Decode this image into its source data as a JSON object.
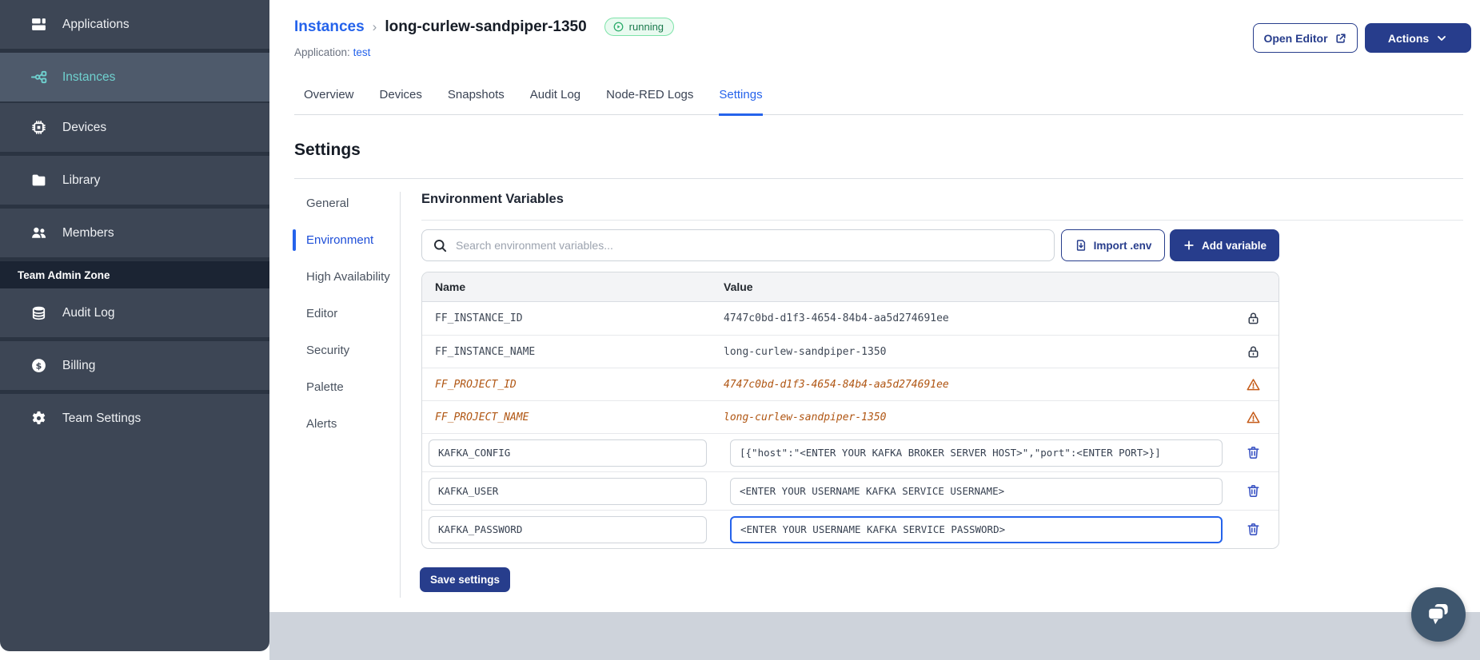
{
  "sidebar": {
    "items": [
      {
        "label": "Applications",
        "icon": "applications",
        "active": false
      },
      {
        "label": "Instances",
        "icon": "instances",
        "active": true
      },
      {
        "label": "Devices",
        "icon": "devices",
        "active": false
      },
      {
        "label": "Library",
        "icon": "library",
        "active": false
      },
      {
        "label": "Members",
        "icon": "members",
        "active": false
      }
    ],
    "section_label": "Team Admin Zone",
    "admin_items": [
      {
        "label": "Audit Log",
        "icon": "audit-log",
        "active": false
      },
      {
        "label": "Billing",
        "icon": "billing",
        "active": false
      },
      {
        "label": "Team Settings",
        "icon": "team-settings",
        "active": false
      }
    ]
  },
  "header": {
    "breadcrumb_root": "Instances",
    "breadcrumb_separator": "›",
    "instance_name": "long-curlew-sandpiper-1350",
    "status_badge": "running",
    "application_label": "Application:",
    "application_name": "test",
    "open_editor_label": "Open Editor",
    "actions_label": "Actions"
  },
  "tabs": [
    {
      "label": "Overview",
      "active": false
    },
    {
      "label": "Devices",
      "active": false
    },
    {
      "label": "Snapshots",
      "active": false
    },
    {
      "label": "Audit Log",
      "active": false
    },
    {
      "label": "Node-RED Logs",
      "active": false
    },
    {
      "label": "Settings",
      "active": true
    }
  ],
  "settings": {
    "title": "Settings",
    "nav": [
      {
        "label": "General",
        "active": false
      },
      {
        "label": "Environment",
        "active": true
      },
      {
        "label": "High Availability",
        "active": false
      },
      {
        "label": "Editor",
        "active": false
      },
      {
        "label": "Security",
        "active": false
      },
      {
        "label": "Palette",
        "active": false
      },
      {
        "label": "Alerts",
        "active": false
      }
    ],
    "section_title": "Environment Variables",
    "search_placeholder": "Search environment variables...",
    "import_label": "Import .env",
    "add_label": "Add variable",
    "save_label": "Save settings",
    "table": {
      "col_name": "Name",
      "col_value": "Value",
      "rows": [
        {
          "name": "FF_INSTANCE_ID",
          "value": "4747c0bd-d1f3-4654-84b4-aa5d274691ee",
          "type": "locked"
        },
        {
          "name": "FF_INSTANCE_NAME",
          "value": "long-curlew-sandpiper-1350",
          "type": "locked"
        },
        {
          "name": "FF_PROJECT_ID",
          "value": "4747c0bd-d1f3-4654-84b4-aa5d274691ee",
          "type": "deprecated"
        },
        {
          "name": "FF_PROJECT_NAME",
          "value": "long-curlew-sandpiper-1350",
          "type": "deprecated"
        },
        {
          "name": "KAFKA_CONFIG",
          "value": "[{\"host\":\"<ENTER YOUR KAFKA BROKER SERVER HOST>\",\"port\":<ENTER PORT>}]",
          "type": "editable",
          "focused": false
        },
        {
          "name": "KAFKA_USER",
          "value": "<ENTER YOUR USERNAME KAFKA SERVICE USERNAME>",
          "type": "editable",
          "focused": false
        },
        {
          "name": "KAFKA_PASSWORD",
          "value": "<ENTER YOUR USERNAME KAFKA SERVICE PASSWORD>",
          "type": "editable",
          "focused": true
        }
      ]
    }
  },
  "colors": {
    "primary_navy": "#273d8c",
    "link_blue": "#2563eb",
    "sidebar_bg": "#3d4655",
    "sidebar_active_bg": "#4e5a6b",
    "sidebar_teal": "#6fd1cf",
    "running_green_text": "#1b7a4d",
    "running_green_border": "#7de3a9",
    "deprecated_orange": "#b05613",
    "warning_orange": "#c55a17",
    "trash_blue": "#3c55c4",
    "footer_gray": "#ced3db"
  }
}
